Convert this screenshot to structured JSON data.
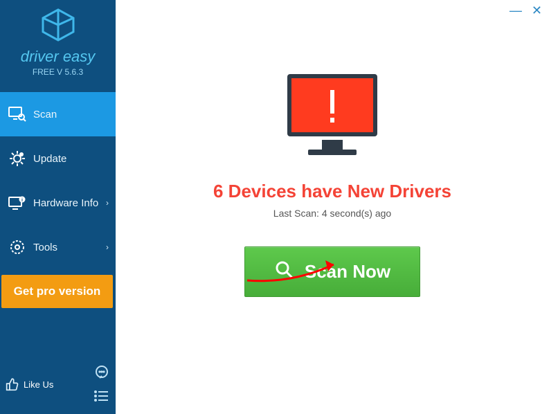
{
  "brand": {
    "name": "driver easy",
    "version": "FREE V 5.6.3"
  },
  "sidebar": {
    "items": [
      {
        "label": "Scan",
        "has_chevron": false
      },
      {
        "label": "Update",
        "has_chevron": false
      },
      {
        "label": "Hardware Info",
        "has_chevron": true
      },
      {
        "label": "Tools",
        "has_chevron": true
      }
    ],
    "pro_label": "Get pro version",
    "like_label": "Like Us"
  },
  "main": {
    "headline": "6 Devices have New Drivers",
    "subline": "Last Scan: 4 second(s) ago",
    "scan_label": "Scan Now"
  },
  "window": {
    "minimize": "—",
    "close": "✕"
  }
}
